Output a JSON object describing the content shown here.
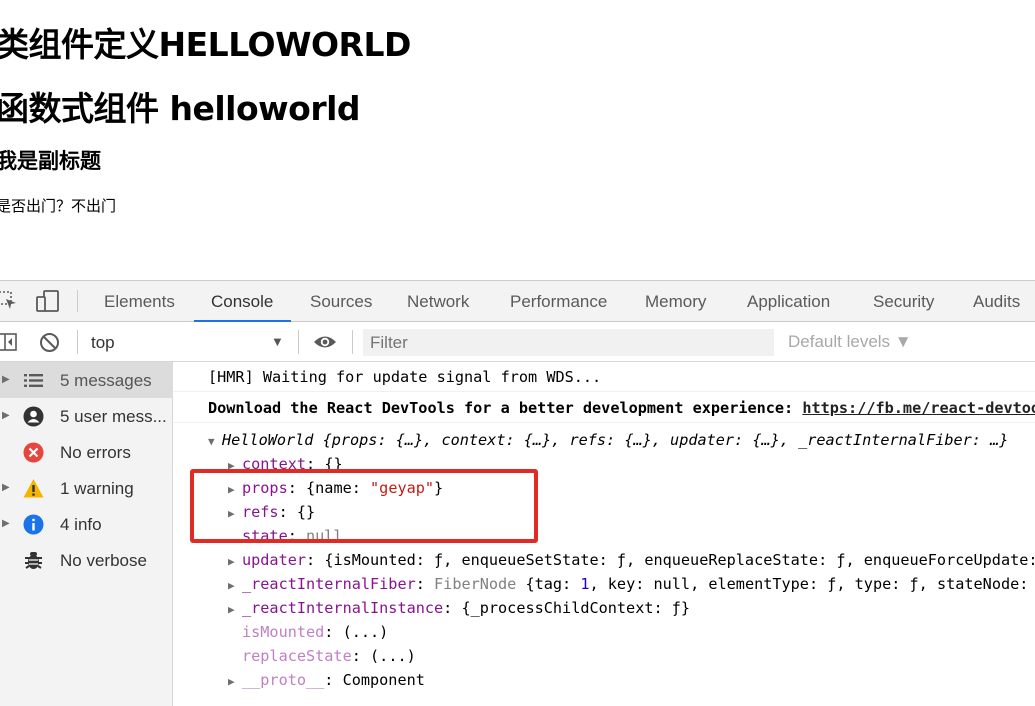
{
  "page": {
    "heading1": "类组件定义HELLOWORLD",
    "heading2": "函数式组件 helloworld",
    "subheading": "我是副标题",
    "paragraph": "是否出门？不出门"
  },
  "devtools": {
    "tabs": [
      "Elements",
      "Console",
      "Sources",
      "Network",
      "Performance",
      "Memory",
      "Application",
      "Security",
      "Audits"
    ],
    "active_tab": "Console",
    "toolbar": {
      "context": "top",
      "filter_placeholder": "Filter",
      "levels": "Default levels ▼"
    },
    "sidebar": [
      {
        "label": "5 messages",
        "icon": "list-icon"
      },
      {
        "label": "5 user mess...",
        "icon": "user-icon"
      },
      {
        "label": "No errors",
        "icon": "error-icon"
      },
      {
        "label": "1 warning",
        "icon": "warning-icon"
      },
      {
        "label": "4 info",
        "icon": "info-icon"
      },
      {
        "label": "No verbose",
        "icon": "bug-icon"
      }
    ],
    "console": {
      "hmr": "[HMR] Waiting for update signal from WDS...",
      "download": "Download the React DevTools for a better development experience: ",
      "download_link": "https://fb.me/react-devtools",
      "obj_name": "HelloWorld",
      "obj_summary": "{props: {…}, context: {…}, refs: {…}, updater: {…}, _reactInternalFiber: …}",
      "context_key": "context",
      "context_val": "{}",
      "props_key": "props",
      "props_val_pre": "{name: ",
      "props_val_str": "\"geyap\"",
      "props_val_post": "}",
      "refs_key": "refs",
      "refs_val": "{}",
      "state_key": "state",
      "state_val": "null",
      "updater_key": "updater",
      "updater_val": "{isMounted: ƒ, enqueueSetState: ƒ, enqueueReplaceState: ƒ, enqueueForceUpdate: ƒ}",
      "fiber_key": "_reactInternalFiber",
      "fiber_type": "FiberNode ",
      "fiber_pre": "{tag: ",
      "fiber_tag": "1",
      "fiber_post": ", key: null, elementType: ƒ, type: ƒ, stateNode: …}",
      "instance_key": "_reactInternalInstance",
      "instance_val": "{_processChildContext: ƒ}",
      "ismounted_key": "isMounted",
      "ismounted_val": "(...)",
      "replacestate_key": "replaceState",
      "replacestate_val": "(...)",
      "proto_key": "__proto__",
      "proto_val": "Component"
    }
  }
}
